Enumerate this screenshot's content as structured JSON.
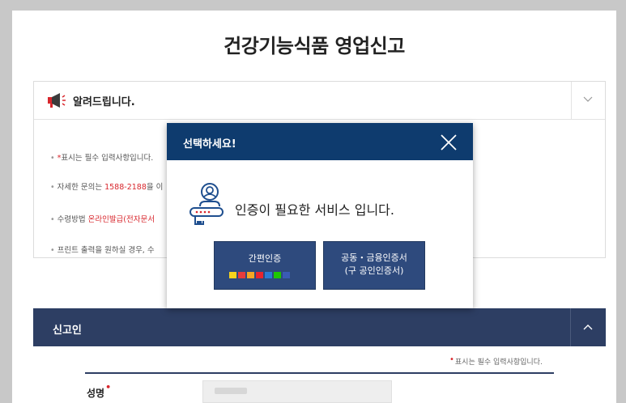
{
  "page": {
    "title": "건강기능식품 영업신고"
  },
  "notice": {
    "title": "알려드립니다.",
    "icon": "megaphone-icon",
    "lines": [
      {
        "prefix": "*",
        "text": "표시는 필수 입력사항입니다."
      },
      {
        "before": "자세한 문의는 ",
        "highlight": "1588-2188",
        "after": "을 이"
      },
      {
        "before": "수령방법 ",
        "highlight": "온라인발급(전자문서",
        "after": ""
      },
      {
        "text": "프린트 출력을 원하실 경우, 수"
      }
    ]
  },
  "section": {
    "title": "신고인"
  },
  "form": {
    "required_note": "표시는 필수 입력사항입니다.",
    "required_mark": "•",
    "name_label": "성명"
  },
  "modal": {
    "title": "선택하세요!",
    "message": "인증이 필요한 서비스 입니다.",
    "buttons": [
      {
        "label": "간편인증"
      },
      {
        "label_line1": "공동・금융인증서",
        "label_line2": "(구 공인인증서)"
      }
    ],
    "provider_colors": [
      "#f7d31d",
      "#e63c3c",
      "#f5a623",
      "#e8252e",
      "#1ec800",
      "#2b7cd3",
      "#3a5bb5"
    ]
  },
  "colors": {
    "header_navy": "#0e3b6e",
    "section_navy": "#2d3e63",
    "button_blue": "#2e4a7d",
    "accent_red": "#d8262c"
  }
}
